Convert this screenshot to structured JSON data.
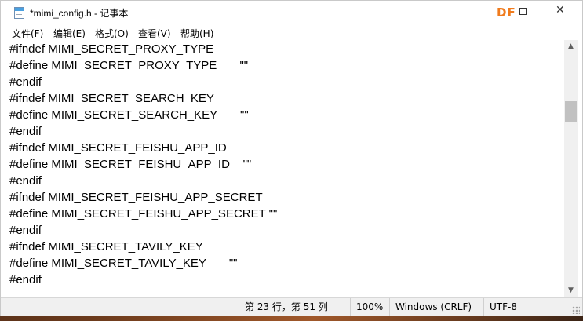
{
  "window": {
    "title": "*mimi_config.h - 记事本",
    "watermark": "DF",
    "close_glyph": "✕"
  },
  "menu": {
    "items": [
      "文件(F)",
      "编辑(E)",
      "格式(O)",
      "查看(V)",
      "帮助(H)"
    ]
  },
  "editor": {
    "lines": [
      "#ifndef MIMI_SECRET_PROXY_TYPE",
      "#define MIMI_SECRET_PROXY_TYPE       \"\"",
      "#endif",
      "#ifndef MIMI_SECRET_SEARCH_KEY",
      "#define MIMI_SECRET_SEARCH_KEY       \"\"",
      "#endif",
      "#ifndef MIMI_SECRET_FEISHU_APP_ID",
      "#define MIMI_SECRET_FEISHU_APP_ID    \"\"",
      "#endif",
      "#ifndef MIMI_SECRET_FEISHU_APP_SECRET",
      "#define MIMI_SECRET_FEISHU_APP_SECRET \"\"",
      "#endif",
      "#ifndef MIMI_SECRET_TAVILY_KEY",
      "#define MIMI_SECRET_TAVILY_KEY       \"\"",
      "#endif"
    ]
  },
  "status": {
    "position": "第 23 行，第 51 列",
    "zoom": "100%",
    "line_ending": "Windows (CRLF)",
    "encoding": "UTF-8"
  },
  "scrollbar": {
    "up_glyph": "▲",
    "down_glyph": "▼"
  }
}
